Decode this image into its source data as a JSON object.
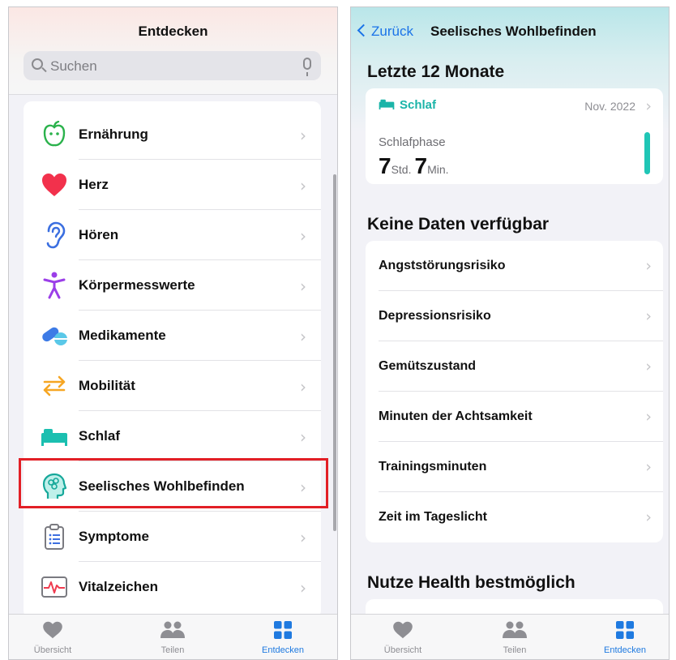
{
  "left": {
    "title": "Entdecken",
    "search_placeholder": "Suchen",
    "items": [
      {
        "label": "Ernährung",
        "icon": "apple-icon"
      },
      {
        "label": "Herz",
        "icon": "heart-icon"
      },
      {
        "label": "Hören",
        "icon": "ear-icon"
      },
      {
        "label": "Körpermesswerte",
        "icon": "figure-icon"
      },
      {
        "label": "Medikamente",
        "icon": "pills-icon"
      },
      {
        "label": "Mobilität",
        "icon": "arrows-icon"
      },
      {
        "label": "Schlaf",
        "icon": "bed-icon"
      },
      {
        "label": "Seelisches Wohlbefinden",
        "icon": "mind-icon"
      },
      {
        "label": "Symptome",
        "icon": "clipboard-icon"
      },
      {
        "label": "Vitalzeichen",
        "icon": "vitals-icon"
      }
    ],
    "highlighted": "Seelisches Wohlbefinden"
  },
  "right": {
    "back_label": "Zurück",
    "title": "Seelisches Wohlbefinden",
    "section_recent": "Letzte 12 Monate",
    "sleep_card": {
      "category": "Schlaf",
      "date": "Nov. 2022",
      "metric": "Schlafphase",
      "hours": "7",
      "hours_unit": "Std.",
      "minutes": "7",
      "minutes_unit": "Min."
    },
    "section_nodata": "Keine Daten verfügbar",
    "nodata_items": [
      "Angststörungsrisiko",
      "Depressionsrisiko",
      "Gemütszustand",
      "Minuten der Achtsamkeit",
      "Trainingsminuten",
      "Zeit im Tageslicht"
    ],
    "section_tips": "Nutze Health bestmöglich"
  },
  "tabs": [
    {
      "label": "Übersicht",
      "icon": "heart-icon"
    },
    {
      "label": "Teilen",
      "icon": "people-icon"
    },
    {
      "label": "Entdecken",
      "icon": "grid-icon",
      "active": true
    }
  ],
  "colors": {
    "accent_blue": "#1a73e8",
    "sleep_teal": "#1ab4a8",
    "highlight_red": "#e21f26"
  }
}
